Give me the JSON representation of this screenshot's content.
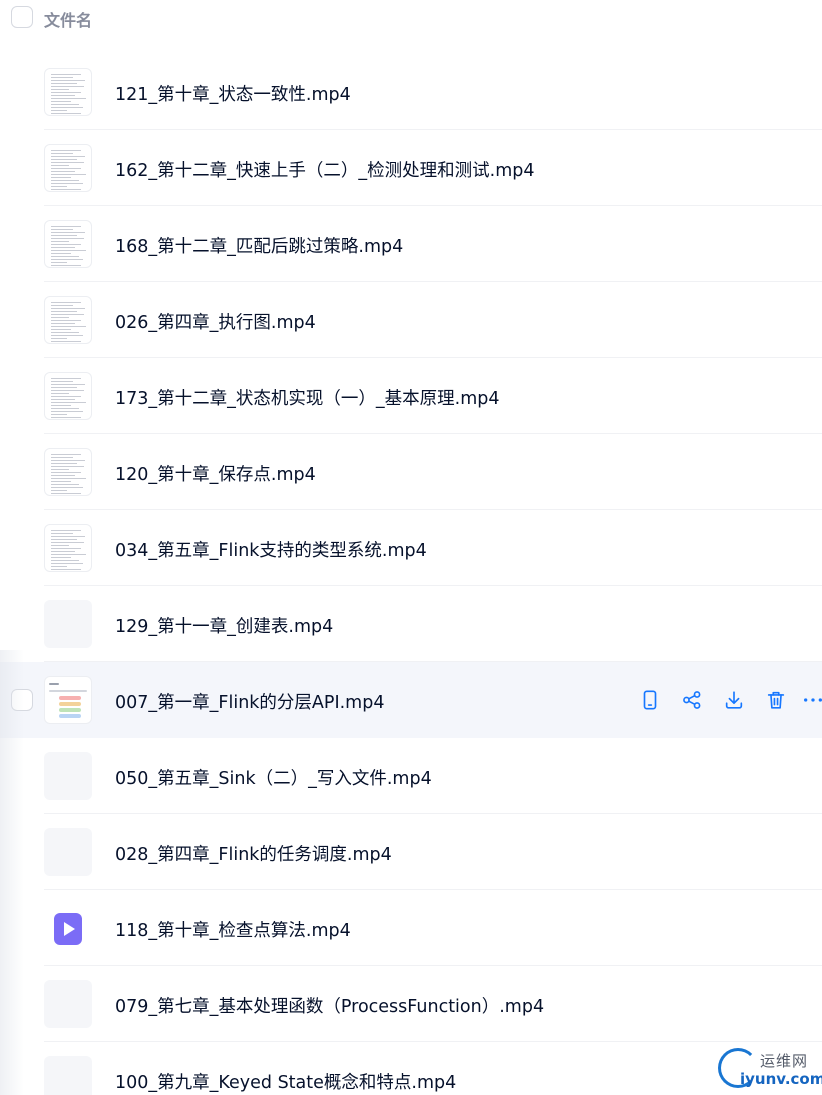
{
  "header": {
    "column_label": "文件名"
  },
  "files": [
    {
      "name": "121_第十章_状态一致性.mp4",
      "thumb": "doc"
    },
    {
      "name": "162_第十二章_快速上手（二）_检测处理和测试.mp4",
      "thumb": "doc"
    },
    {
      "name": "168_第十二章_匹配后跳过策略.mp4",
      "thumb": "doc"
    },
    {
      "name": "026_第四章_执行图.mp4",
      "thumb": "doc"
    },
    {
      "name": "173_第十二章_状态机实现（一）_基本原理.mp4",
      "thumb": "doc"
    },
    {
      "name": "120_第十章_保存点.mp4",
      "thumb": "doc"
    },
    {
      "name": "034_第五章_Flink支持的类型系统.mp4",
      "thumb": "doc"
    },
    {
      "name": "129_第十一章_创建表.mp4",
      "thumb": "blank"
    },
    {
      "name": "007_第一章_Flink的分层API.mp4",
      "thumb": "slide",
      "active": true
    },
    {
      "name": "050_第五章_Sink（二）_写入文件.mp4",
      "thumb": "blank"
    },
    {
      "name": "028_第四章_Flink的任务调度.mp4",
      "thumb": "blank"
    },
    {
      "name": "118_第十章_检查点算法.mp4",
      "thumb": "video"
    },
    {
      "name": "079_第七章_基本处理函数（ProcessFunction）.mp4",
      "thumb": "blank"
    },
    {
      "name": "100_第九章_Keyed State概念和特点.mp4",
      "thumb": "blank"
    }
  ],
  "actions": [
    {
      "name": "phone-icon"
    },
    {
      "name": "share-icon"
    },
    {
      "name": "download-icon"
    },
    {
      "name": "delete-icon"
    },
    {
      "name": "more-icon"
    }
  ],
  "watermark": {
    "top": "运维网",
    "bottom": "iyunv.com"
  },
  "colors": {
    "accent": "#1677ff",
    "text": "#06112b",
    "muted": "#878c9c",
    "active_row": "#f4f6fb"
  }
}
